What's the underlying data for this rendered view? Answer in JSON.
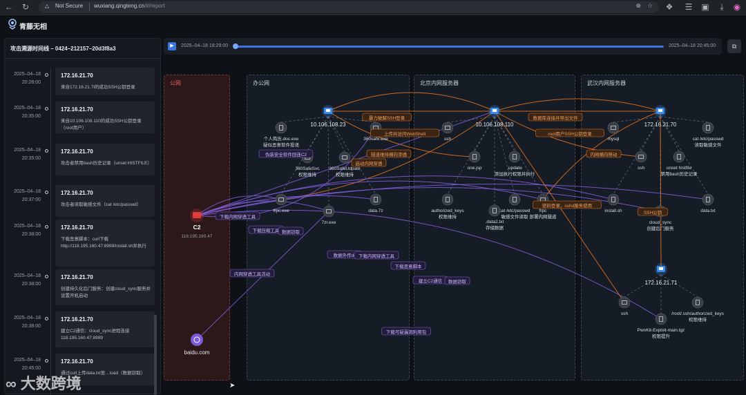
{
  "browser": {
    "security": "Not Secure",
    "url_host": "wuxiang.qingteng.cn",
    "url_path": "/#/report"
  },
  "app": {
    "name": "青藤无相"
  },
  "sidebar": {
    "title": "攻击溯源时间线 – 0424–212157–20d3f8a3",
    "events": [
      {
        "date": "2025–04–18",
        "time": "20:28:00",
        "ip": "172.16.21.70",
        "desc": "来自172.16.21.7l的成功SSH公钥登录"
      },
      {
        "date": "2025–04–18",
        "time": "20:35:00",
        "ip": "172.16.21.70",
        "desc": "来自10.106.108.110的成功SSH公钥登录（root用户）"
      },
      {
        "date": "2025–04–18",
        "time": "20:35:00",
        "ip": "172.16.21.70",
        "desc": "攻击者禁用bash历史记录（unset HISTFILE）"
      },
      {
        "date": "2025–04–18",
        "time": "20:37:00",
        "ip": "172.16.21.70",
        "desc": "攻击者读取敏感文件（cat /etc/passwd）"
      },
      {
        "date": "2025–04–18",
        "time": "20:38:00",
        "ip": "172.16.21.70",
        "desc": "下载恶意脚本：curl下载http://118.195.160.47:8999/install.sh并执行"
      },
      {
        "date": "2025–04–18",
        "time": "20:38:00",
        "ip": "172.16.21.70",
        "desc": "创建持久化后门服务：创建cloud_sync服务并设置开机启动"
      },
      {
        "date": "2025–04–18",
        "time": "20:38:00",
        "ip": "172.16.21.70",
        "desc": "建立C2通信：cloud_sync进程连接118.195.160.47:8989"
      },
      {
        "date": "2025–04–18",
        "time": "20:45:00",
        "ip": "172.16.21.70",
        "desc": "通过curl上传data.txt至…load（数据窃取）"
      }
    ]
  },
  "timeline": {
    "start": "2025–04–18 18:29:00",
    "end": "2025–04–18 20:45:00",
    "play_icon": "play-icon"
  },
  "zones": {
    "public": "公网",
    "office": "办公网",
    "beijing": "北京内网服务器",
    "wuhan": "武汉内网服务器"
  },
  "hosts": {
    "c2": {
      "name": "C2",
      "ip": "118.195.160.47"
    },
    "baidu": {
      "name": "baidu.com"
    },
    "h1": "10.106.108.23",
    "h2": "10.106.108.110",
    "h3": "172.16.21.70",
    "h4": "172.16.21.71"
  },
  "nodes": {
    "resume": [
      "个人简历.doc.exe",
      "疑似恶意软件投递"
    ],
    "safe_exe": [
      "360safe.exe"
    ],
    "safesvc": [
      "360SafeSvc",
      "权限维持"
    ],
    "safeupd": [
      "360SafeUdpate",
      "权限维持"
    ],
    "frpc_exe": [
      "frpc.exe"
    ],
    "z7_exe": [
      "7zr.exe"
    ],
    "data7z": [
      "data.7z"
    ],
    "ssh_bj": [
      "ssh"
    ],
    "one_jsp": [
      "one.jsp"
    ],
    "update": [
      ".update",
      "添加执行权限并执行"
    ],
    "auth_keys": [
      "authorized_keys",
      "权限维持"
    ],
    "cat_bj": [
      "cat /etc/passwd",
      "敏感文件读取"
    ],
    "data2": [
      ".data2.txt",
      "存储数据"
    ],
    "frpc_bj": [
      "frpc",
      "部署内网隧道"
    ],
    "mysql": [
      "mysql"
    ],
    "ssh_wh": [
      "ssh"
    ],
    "cat_wh": [
      "cat /etc/passwd",
      "读取敏感文件"
    ],
    "unset": [
      "unset histfile",
      "禁用bash历史记录"
    ],
    "install": [
      "install.sh"
    ],
    "cloud": [
      "cloud_sync",
      "创建后门服务"
    ],
    "datatxt": [
      "data.txt"
    ],
    "ssh_71": [
      "ssh"
    ],
    "root_auth": [
      "/root/.ssh/authorized_keys",
      "权限维持"
    ],
    "pwnkit": [
      "PwnKit-Exploit-main.tgz",
      "权限提升"
    ]
  },
  "edge_labels": {
    "brute": "暴力破解SSH登录",
    "webshell": "上传并访问WebShell",
    "tunnel_pen": "隧道维持横向渗透",
    "start_tunnel": "启动内网穿透",
    "fake": "伪装安全软件回连C2",
    "db": "数据库连接并导出文件",
    "root_ssh": "root用户SSH公钥登录",
    "lateral": "内网横向移动",
    "pw_login": "密码登录，sshd服务使用",
    "ssh_pub": "SSH公钥",
    "dl_tunnel": "下载内网穿透工具",
    "dl_compress": "下载压缩工具",
    "data_theft": "数据窃取",
    "exfil": "数据外传dc",
    "dl_tunnel2": "下载内网穿透工具",
    "dl_script": "下载恶意脚本",
    "c2_comm": "建立C2通信",
    "data_theft2": "数据窃取",
    "tunnel_active": "内网穿透工具活动",
    "dl_vuln": "下载可疑漏洞利用包"
  },
  "watermark": "大数跨境",
  "colors": {
    "orange": "#e0711d",
    "purple": "#7c5cd6",
    "host": "#3b8cf0",
    "c2": "#e23b3b"
  }
}
